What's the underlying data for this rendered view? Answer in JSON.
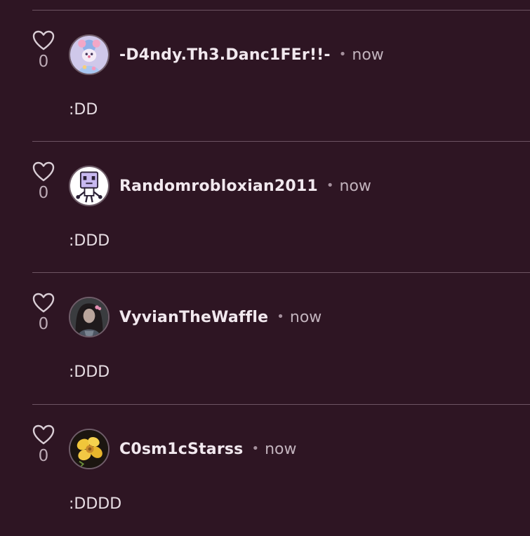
{
  "comments": [
    {
      "username": "-D4ndy.Th3.Danc1FEr!!-",
      "time": "now",
      "text": ":DD",
      "likes": "0",
      "avatar": "pastel-clown-avatar"
    },
    {
      "username": "Randomrobloxian2011",
      "time": "now",
      "text": ":DDD",
      "likes": "0",
      "avatar": "box-robot-avatar"
    },
    {
      "username": "VyvianTheWaffle",
      "time": "now",
      "text": ":DDD",
      "likes": "0",
      "avatar": "dark-hair-person-avatar"
    },
    {
      "username": "C0sm1cStarss",
      "time": "now",
      "text": ":DDDD",
      "likes": "0",
      "avatar": "yellow-flower-avatar"
    }
  ],
  "separator": "•",
  "colors": {
    "background": "#2e1523",
    "divider": "#6d5463",
    "username": "#f1e8ee",
    "muted": "#c2b3bd"
  }
}
